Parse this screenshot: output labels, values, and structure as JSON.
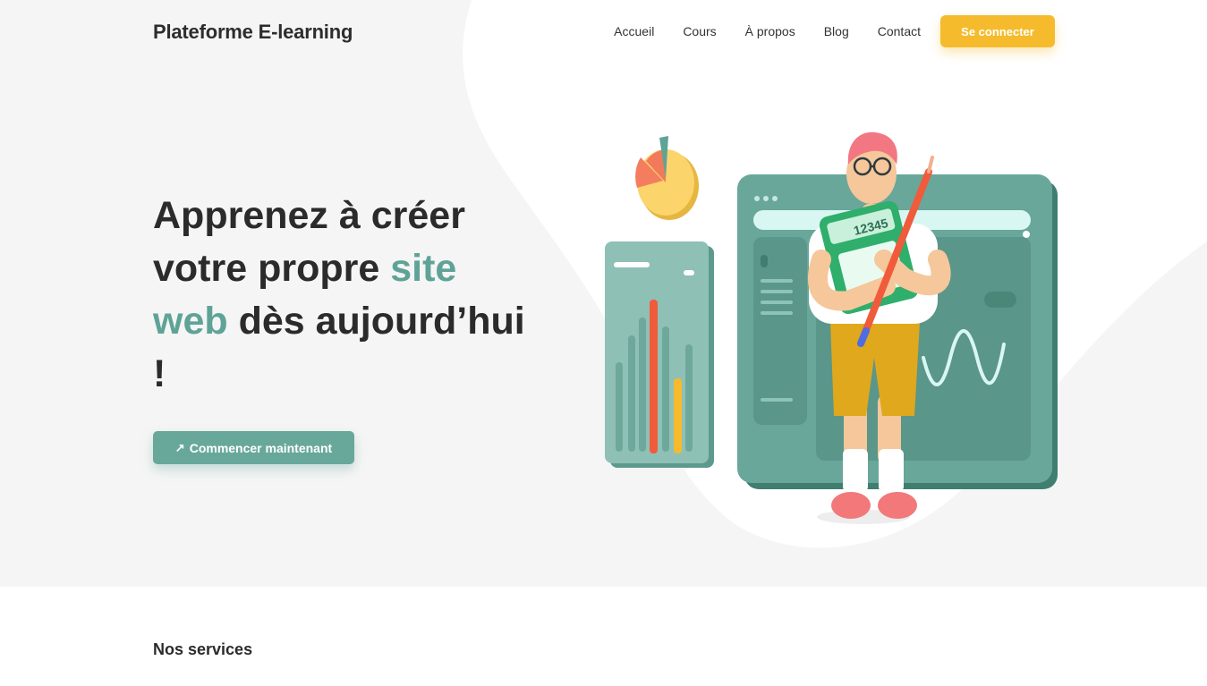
{
  "header": {
    "brand": "Plateforme E-learning",
    "nav": [
      {
        "label": "Accueil"
      },
      {
        "label": "Cours"
      },
      {
        "label": "À propos"
      },
      {
        "label": "Blog"
      },
      {
        "label": "Contact"
      }
    ],
    "login_label": "Se connecter"
  },
  "hero": {
    "title_part1": "Apprenez à créer votre propre ",
    "title_accent": "site web",
    "title_part2": " dès aujourd’hui !",
    "cta_icon": "arrow-up-right-icon",
    "cta_glyph": "↗",
    "cta_label": "Commencer maintenant",
    "illustration": "student-with-calculator-and-dashboard"
  },
  "services": {
    "title": "Nos services"
  },
  "colors": {
    "accent": "#5fa397",
    "button_teal": "#68a89a",
    "login_yellow": "#f5bb2c",
    "hero_bg": "#f5f5f5"
  }
}
